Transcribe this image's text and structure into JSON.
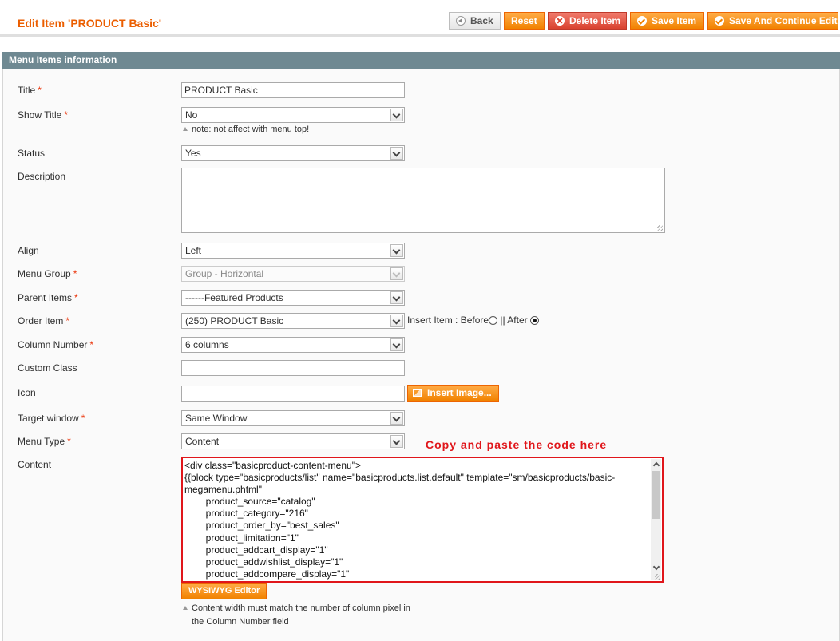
{
  "header": {
    "title": "Edit Item 'PRODUCT Basic'",
    "buttons": {
      "back": "Back",
      "reset": "Reset",
      "delete": "Delete Item",
      "save": "Save Item",
      "save_continue": "Save And Continue Edit"
    }
  },
  "section": {
    "title": "Menu Items information"
  },
  "form": {
    "title": {
      "label": "Title",
      "value": "PRODUCT Basic"
    },
    "show_title": {
      "label": "Show Title",
      "value": "No",
      "note": "note: not affect with menu top!"
    },
    "status": {
      "label": "Status",
      "value": "Yes"
    },
    "description": {
      "label": "Description",
      "value": ""
    },
    "align": {
      "label": "Align",
      "value": "Left"
    },
    "menu_group": {
      "label": "Menu Group",
      "value": "Group - Horizontal"
    },
    "parent_items": {
      "label": "Parent Items",
      "value": "------Featured Products"
    },
    "order_item": {
      "label": "Order Item",
      "value": "(250) PRODUCT Basic",
      "insert_label": "Insert Item : Before",
      "after_label": " || After",
      "selected": "After"
    },
    "column_number": {
      "label": "Column Number",
      "value": "6 columns"
    },
    "custom_class": {
      "label": "Custom Class",
      "value": ""
    },
    "icon": {
      "label": "Icon",
      "value": "",
      "insert_button": "Insert Image..."
    },
    "target_window": {
      "label": "Target window",
      "value": "Same Window"
    },
    "menu_type": {
      "label": "Menu Type",
      "value": "Content"
    },
    "content": {
      "label": "Content",
      "annotation": "Copy and paste the code here",
      "value": "<div class=\"basicproduct-content-menu\">\n{{block type=\"basicproducts/list\" name=\"basicproducts.list.default\" template=\"sm/basicproducts/basic-megamenu.phtml\"\n        product_source=\"catalog\"\n        product_category=\"216\"\n        product_order_by=\"best_sales\"\n        product_limitation=\"1\"\n        product_addcart_display=\"1\"\n        product_addwishlist_display=\"1\"\n        product_addcompare_display=\"1\"",
      "wysiwyg_button": "WYSIWYG Editor",
      "note_line1": "Content width must match the number of column pixel in",
      "note_line2": "the Column Number field"
    },
    "required_mark": "*"
  },
  "colors": {
    "accent": "#eb5e00",
    "button": "#f18200",
    "section_bar": "#6f8992",
    "highlight": "#e0161b"
  }
}
